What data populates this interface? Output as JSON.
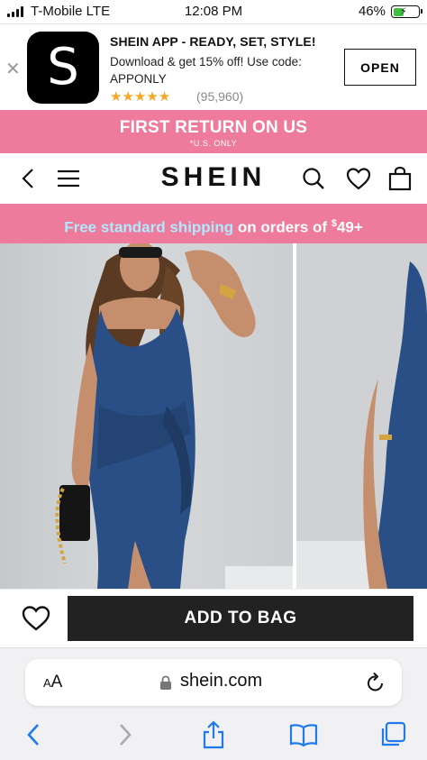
{
  "status_bar": {
    "carrier": "T-Mobile  LTE",
    "time": "12:08 PM",
    "battery": "46%",
    "battery_level": 0.46,
    "signal_icon": "cellular-signal-icon",
    "battery_icon": "battery-charging-icon"
  },
  "app_banner": {
    "close_icon": "close-icon",
    "logo_letter": "S",
    "title": "SHEIN APP - READY, SET, STYLE!",
    "subtitle": "Download & get 15% off! Use code: APPONLY",
    "stars": "★★★★★",
    "rating": 5,
    "review_count": "(95,960)",
    "open_label": "OPEN"
  },
  "promo": {
    "headline": "FIRST RETURN ON US",
    "note": "*U.S. ONLY",
    "background": "#ee7b9b"
  },
  "nav": {
    "brand": "SHEIN",
    "icons": [
      "back-chevron-icon",
      "menu-icon",
      "search-icon",
      "heart-icon",
      "shopping-bag-icon"
    ]
  },
  "shipping": {
    "highlight": "Free standard shipping",
    "middle": " on orders of ",
    "currency": "$",
    "amount": "49+",
    "highlight_color": "#aee9ff"
  },
  "product": {
    "images": [
      "product-photo-front",
      "product-photo-side"
    ],
    "dress_color": "#2a4f86"
  },
  "actions": {
    "wishlist_icon": "heart-outline-icon",
    "add_to_bag": "ADD TO BAG"
  },
  "safari": {
    "text_size_label_small": "A",
    "text_size_label_big": "A",
    "domain": "shein.com",
    "toolbar_icons": [
      "back-icon",
      "forward-icon",
      "share-icon",
      "bookmarks-icon",
      "tabs-icon"
    ],
    "accent": "#1f7aec"
  }
}
